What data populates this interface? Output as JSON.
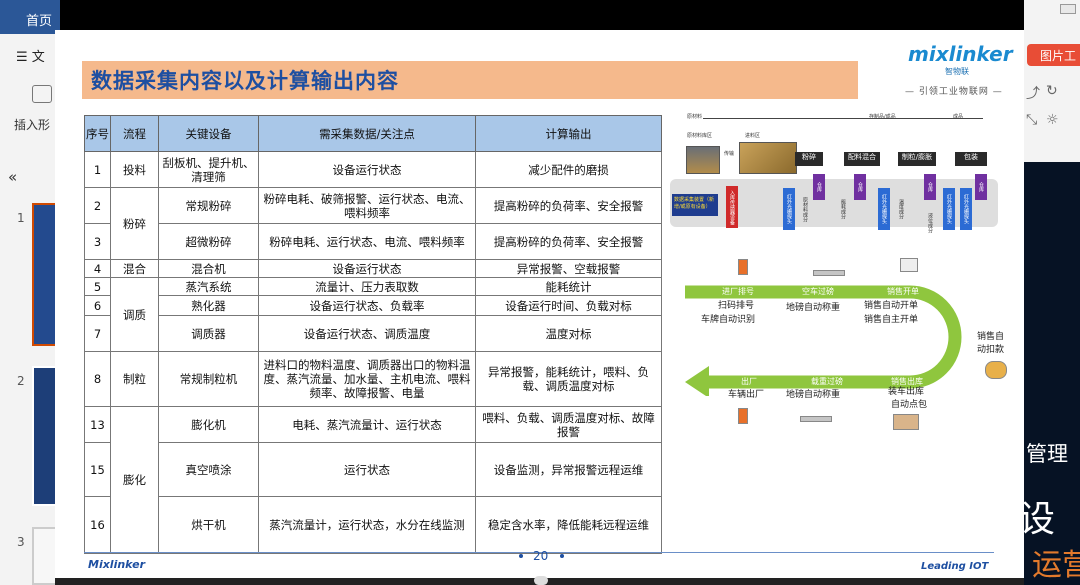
{
  "app": {
    "home_tab": "首页",
    "file_menu": "文",
    "insert_label": "插入形",
    "collapse_icon": "chevron-double-left-icon",
    "picture_tools": "图片工"
  },
  "slides": {
    "numbers": [
      "1",
      "2",
      "3"
    ]
  },
  "right_panel": {
    "line1": "管理",
    "line2": "设",
    "line3": "运营"
  },
  "slide": {
    "title": "数据采集内容以及计算输出内容",
    "logo": "mixlinker",
    "logo_sub": "智物联",
    "slogan": "— 引领工业物联网 —",
    "page_number": "20",
    "footer_left": "Mixlinker",
    "footer_right": "Leading  IOT",
    "table": {
      "headers": [
        "序号",
        "流程",
        "关键设备",
        "需采集数据/关注点",
        "计算输出"
      ],
      "rows": [
        {
          "no": "1",
          "process": "投料",
          "device": "刮板机、提升机、清理筛",
          "data": "设备运行状态",
          "output": "减少配件的磨损"
        },
        {
          "no": "2",
          "process": "粉碎",
          "device": "常规粉碎",
          "data": "粉碎电耗、破筛报警、运行状态、电流、喂料频率",
          "output": "提高粉碎的负荷率、安全报警"
        },
        {
          "no": "3",
          "device": "超微粉碎",
          "data": "粉碎电耗、运行状态、电流、喂料频率",
          "output": "提高粉碎的负荷率、安全报警"
        },
        {
          "no": "4",
          "process": "混合",
          "device": "混合机",
          "data": "设备运行状态",
          "output": "异常报警、空载报警"
        },
        {
          "no": "5",
          "process": "调质",
          "device": "蒸汽系统",
          "data": "流量计、压力表取数",
          "output": "能耗统计"
        },
        {
          "no": "6",
          "device": "熟化器",
          "data": "设备运行状态、负载率",
          "output": "设备运行时间、负载对标"
        },
        {
          "no": "7",
          "device": "调质器",
          "data": "设备运行状态、调质温度",
          "output": "温度对标"
        },
        {
          "no": "8",
          "process": "制粒",
          "device": "常规制粒机",
          "data": "进料口的物料温度、调质器出口的物料温度、蒸汽流量、加水量、主机电流、喂料频率、故障报警、电量",
          "output": "异常报警，能耗统计，喂料、负载、调质温度对标"
        },
        {
          "no": "13",
          "process": "膨化",
          "device": "膨化机",
          "data": "电耗、蒸汽流量计、运行状态",
          "output": "喂料、负载、调质温度对标、故障报警"
        },
        {
          "no": "15",
          "device": "真空喷涂",
          "data": "运行状态",
          "output": "设备监测，异常报警远程运维"
        },
        {
          "no": "16",
          "device": "烘干机",
          "data": "蒸汽流量计，运行状态，水分在线监测",
          "output": "稳定含水率，降低能耗远程运维"
        }
      ]
    },
    "flow": {
      "top_labels": [
        "原材料",
        "存制品/成品",
        "成品"
      ],
      "stage_labels": [
        "原材料库区",
        "传输",
        "进料区"
      ],
      "process_boxes": [
        "粉碎",
        "配料混合",
        "制粒/膨胀",
        "包装"
      ],
      "left_box": "数据采集装置（新增/或原有设备）",
      "red_box": "入库传感器设备",
      "purple_tags": [
        "仓库",
        "仓库",
        "仓库",
        "仓库"
      ],
      "blue_tags": [
        "红外光栅探头",
        "红外光栅探头",
        "红外光栅探头",
        "红外光栅探头"
      ],
      "small_notes": [
        "原材料成分",
        "能耗成分",
        "温度成分",
        "液位成分"
      ]
    },
    "logistics": {
      "steps": [
        "进厂排号",
        "空车过磅",
        "销售开单",
        "销售出库",
        "载重过磅",
        "出厂"
      ],
      "labels": [
        "扫码排号",
        "车牌自动识别",
        "地磅自动称重",
        "销售自动开单",
        "销售自主开单",
        "销售自动扣款",
        "装车出库",
        "自动点包",
        "地磅自动称重",
        "车辆出厂"
      ]
    }
  }
}
